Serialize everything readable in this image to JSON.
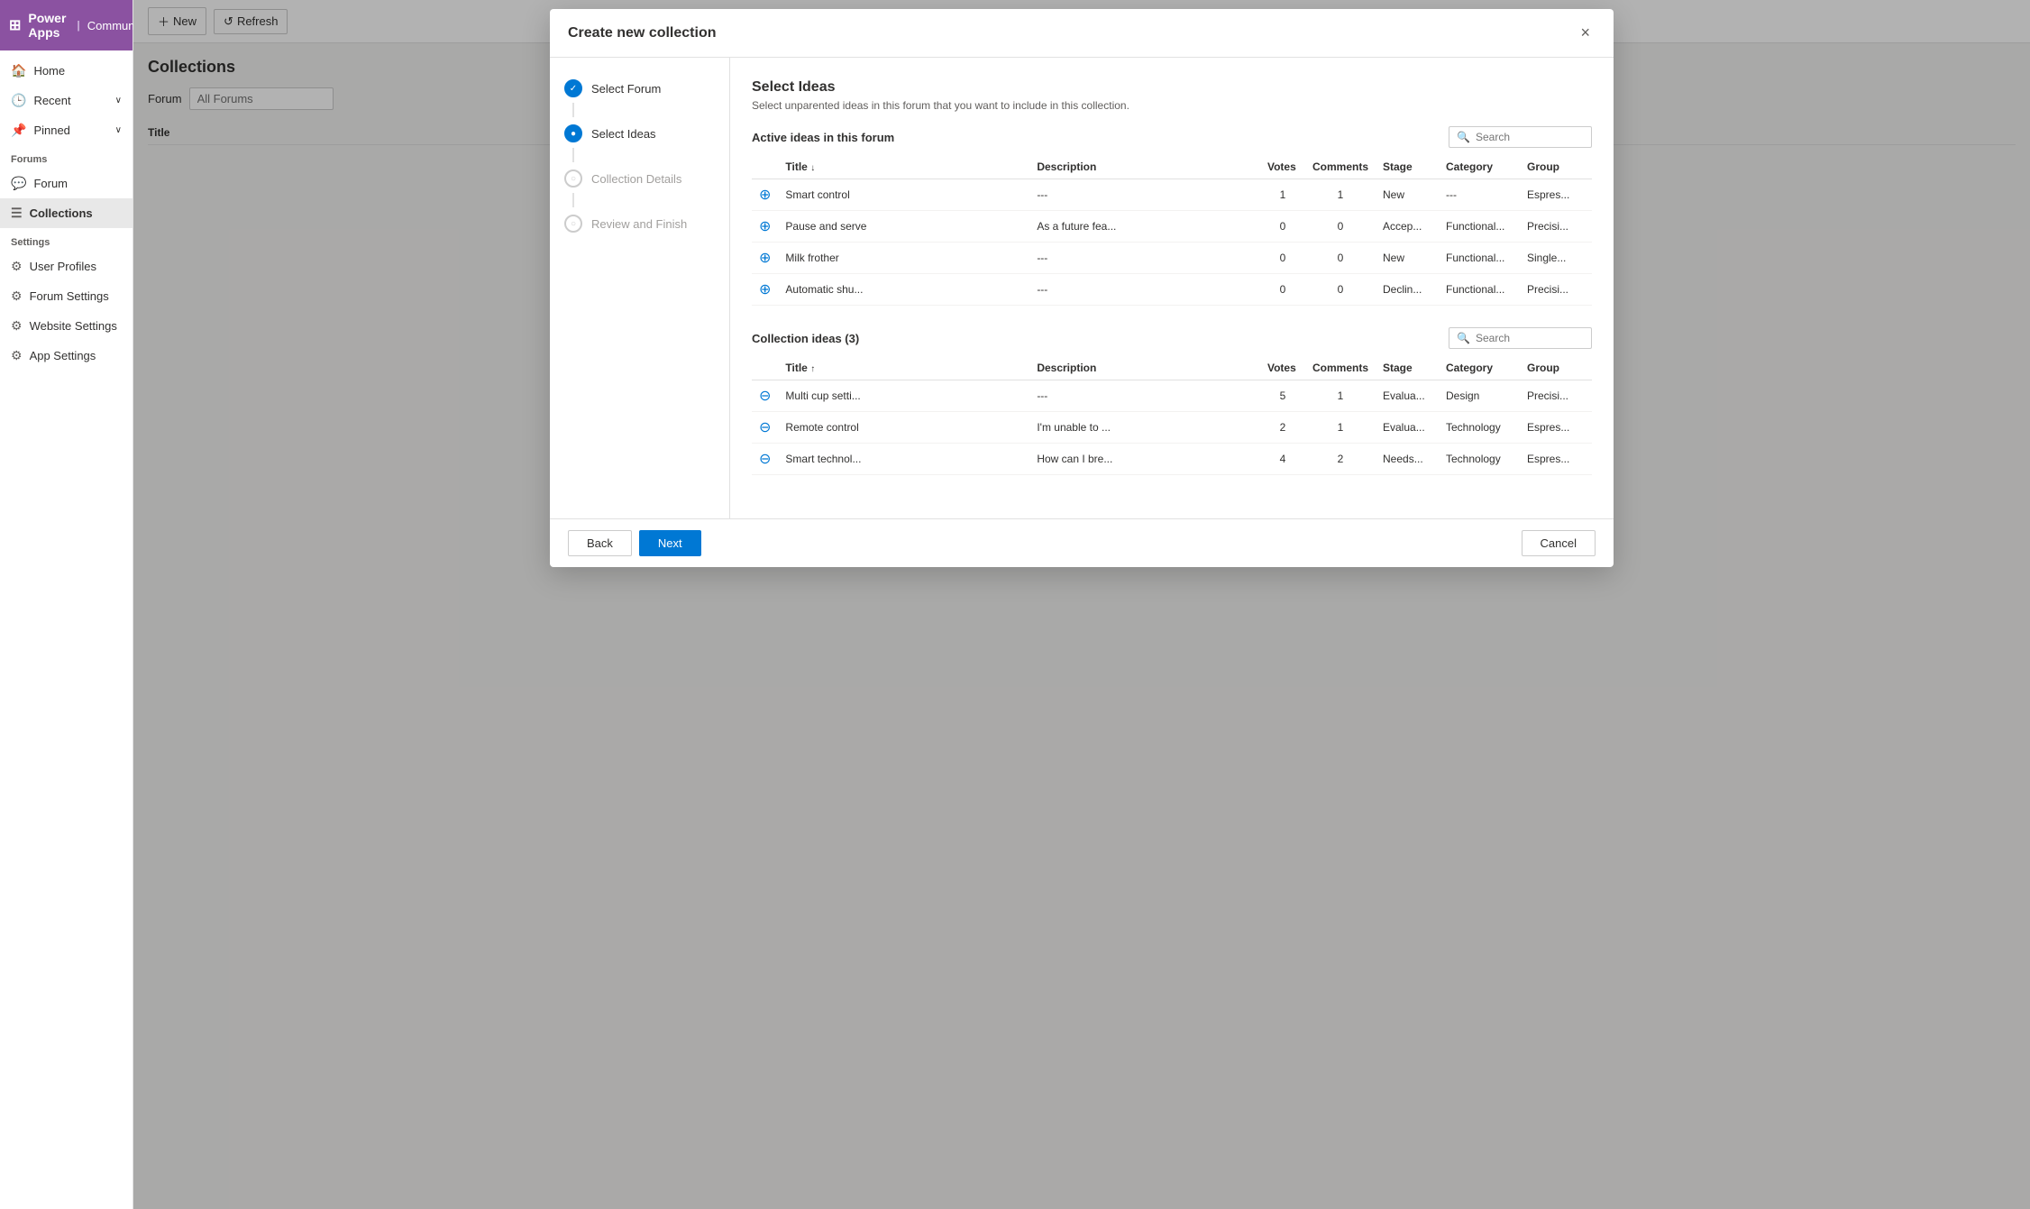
{
  "app": {
    "name": "Power Apps",
    "community": "Community"
  },
  "sidebar": {
    "nav_items": [
      {
        "id": "home",
        "label": "Home",
        "icon": "🏠",
        "has_chevron": false
      },
      {
        "id": "recent",
        "label": "Recent",
        "icon": "🕒",
        "has_chevron": true
      },
      {
        "id": "pinned",
        "label": "Pinned",
        "icon": "📌",
        "has_chevron": true
      }
    ],
    "forums_section": "Forums",
    "forums_items": [
      {
        "id": "forum",
        "label": "Forum",
        "icon": "💬",
        "active": false
      },
      {
        "id": "collections",
        "label": "Collections",
        "icon": "≡",
        "active": true
      }
    ],
    "settings_section": "Settings",
    "settings_items": [
      {
        "id": "user-profiles",
        "label": "User Profiles",
        "icon": "⚙"
      },
      {
        "id": "forum-settings",
        "label": "Forum Settings",
        "icon": "⚙"
      },
      {
        "id": "website-settings",
        "label": "Website Settings",
        "icon": "⚙"
      },
      {
        "id": "app-settings",
        "label": "App Settings",
        "icon": "⚙"
      }
    ]
  },
  "toolbar": {
    "new_label": "New",
    "refresh_label": "Refresh"
  },
  "content": {
    "title": "Collections",
    "forum_label": "Forum",
    "forum_placeholder": "All Forums",
    "table_column": "Title"
  },
  "modal": {
    "title": "Create new collection",
    "close_label": "×",
    "steps": [
      {
        "id": "select-forum",
        "label": "Select Forum",
        "state": "completed"
      },
      {
        "id": "select-ideas",
        "label": "Select Ideas",
        "state": "active"
      },
      {
        "id": "collection-details",
        "label": "Collection Details",
        "state": "inactive"
      },
      {
        "id": "review-finish",
        "label": "Review and Finish",
        "state": "inactive"
      }
    ],
    "select_ideas": {
      "title": "Select Ideas",
      "subtitle": "Select unparented ideas in this forum that you want to include in this collection.",
      "active_section_label": "Active ideas in this forum",
      "active_search_placeholder": "Search",
      "active_columns": [
        "Title",
        "Description",
        "Votes",
        "Comments",
        "Stage",
        "Category",
        "Group"
      ],
      "title_sort": "↓",
      "active_rows": [
        {
          "title": "Smart control",
          "description": "---",
          "votes": "1",
          "comments": "1",
          "stage": "New",
          "category": "---",
          "group": "Espres..."
        },
        {
          "title": "Pause and serve",
          "description": "As a future fea...",
          "votes": "0",
          "comments": "0",
          "stage": "Accep...",
          "category": "Functional...",
          "group": "Precisi..."
        },
        {
          "title": "Milk frother",
          "description": "---",
          "votes": "0",
          "comments": "0",
          "stage": "New",
          "category": "Functional...",
          "group": "Single..."
        },
        {
          "title": "Automatic shu...",
          "description": "---",
          "votes": "0",
          "comments": "0",
          "stage": "Declin...",
          "category": "Functional...",
          "group": "Precisi..."
        }
      ],
      "collection_section_label": "Collection ideas (3)",
      "collection_search_placeholder": "Search",
      "collection_title_sort": "↑",
      "collection_rows": [
        {
          "title": "Multi cup setti...",
          "description": "---",
          "votes": "5",
          "comments": "1",
          "stage": "Evalua...",
          "category": "Design",
          "group": "Precisi..."
        },
        {
          "title": "Remote control",
          "description": "I'm unable to ...",
          "votes": "2",
          "comments": "1",
          "stage": "Evalua...",
          "category": "Technology",
          "group": "Espres..."
        },
        {
          "title": "Smart technol...",
          "description": "How can I bre...",
          "votes": "4",
          "comments": "2",
          "stage": "Needs...",
          "category": "Technology",
          "group": "Espres..."
        }
      ]
    },
    "footer": {
      "back_label": "Back",
      "next_label": "Next",
      "cancel_label": "Cancel"
    }
  }
}
